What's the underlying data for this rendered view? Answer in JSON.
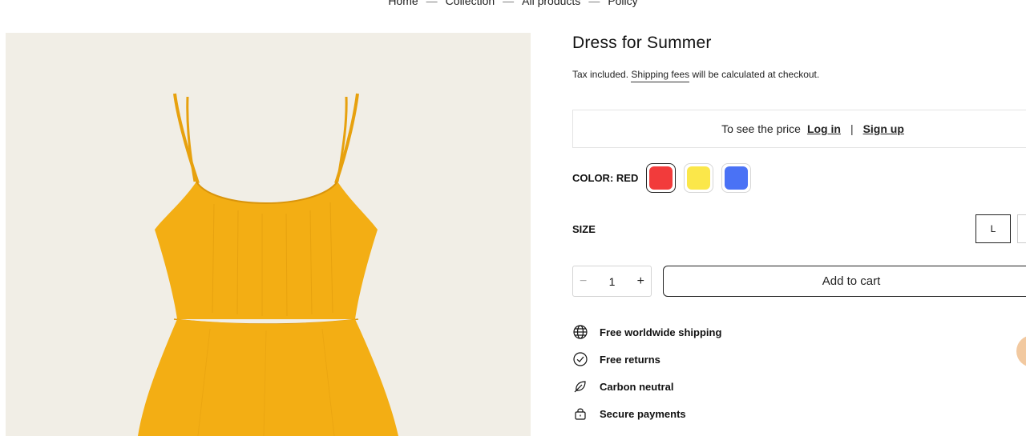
{
  "breadcrumb": [
    "Home",
    "Collection",
    "All products",
    "Policy"
  ],
  "product": {
    "title": "Dress for Summer",
    "tax_prefix": "Tax included.",
    "tax_link": "Shipping fees",
    "tax_suffix": "will be calculated at checkout.",
    "price_prompt": "To see the price",
    "login_label": "Log in",
    "separator": "|",
    "signup_label": "Sign up"
  },
  "color": {
    "label": "COLOR: RED",
    "swatches": [
      {
        "name": "Red",
        "hex": "#f23b3b",
        "selected": true
      },
      {
        "name": "Yellow",
        "hex": "#fbe74a",
        "selected": false
      },
      {
        "name": "Blue",
        "hex": "#4a72f5",
        "selected": false
      }
    ]
  },
  "size": {
    "label": "SIZE",
    "options": [
      "L"
    ],
    "selected": "L"
  },
  "quantity": {
    "minus": "−",
    "value": "1",
    "plus": "+"
  },
  "add_to_cart_label": "Add to cart",
  "features": [
    {
      "icon": "globe-icon",
      "label": "Free worldwide shipping"
    },
    {
      "icon": "check-circle-icon",
      "label": "Free returns"
    },
    {
      "icon": "leaf-icon",
      "label": "Carbon neutral"
    },
    {
      "icon": "lock-icon",
      "label": "Secure payments"
    }
  ],
  "colors": {
    "image_bg": "#efebe3",
    "dress": "#f3ae14"
  }
}
